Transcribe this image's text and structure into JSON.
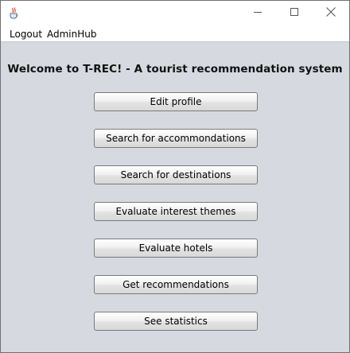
{
  "window": {
    "icon": "java-cup-icon",
    "controls": [
      "minimize-icon",
      "maximize-icon",
      "close-icon"
    ]
  },
  "menubar": {
    "items": [
      "Logout",
      "AdminHub"
    ]
  },
  "main": {
    "heading": "Welcome to T-REC! - A tourist recommendation system",
    "buttons": [
      "Edit profile",
      "Search for accommondations",
      "Search for destinations",
      "Evaluate interest themes",
      "Evaluate hotels",
      "Get recommendations",
      "See statistics"
    ]
  },
  "colors": {
    "panel_bg": "#d6d9df",
    "titlebar_bg": "#ffffff"
  }
}
